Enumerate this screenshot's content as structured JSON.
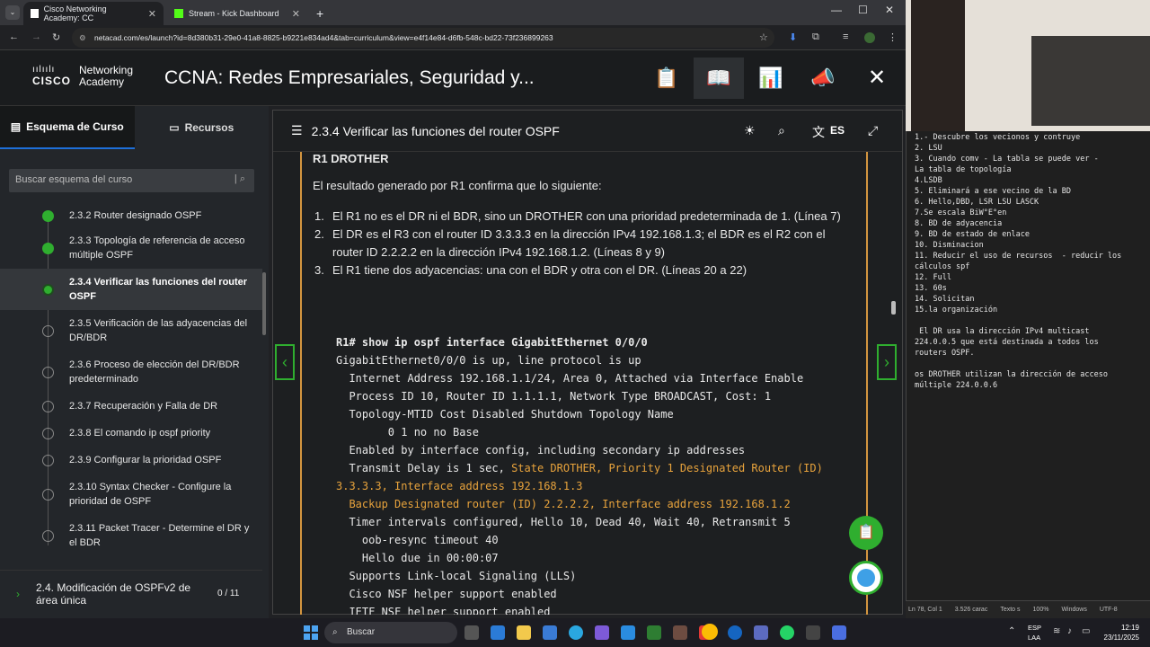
{
  "browser": {
    "tabs": [
      {
        "title": "Cisco Networking Academy: CC"
      },
      {
        "title": "Stream - Kick Dashboard"
      }
    ],
    "url": "netacad.com/es/launch?id=8d380b31-29e0-41a8-8825-b9221e834ad4&tab=curriculum&view=e4f14e84-d6fb-548c-bd22-73f236899263"
  },
  "header": {
    "brand_top": "Networking",
    "brand_bottom": "Academy",
    "cisco": "CISCO",
    "course_title": "CCNA: Redes Empresariales, Seguridad y..."
  },
  "sidebar": {
    "tab_outline": "Esquema de Curso",
    "tab_resources": "Recursos",
    "search_placeholder": "Buscar esquema del curso",
    "items": [
      {
        "label": "2.3.2 Router designado OSPF",
        "state": "done"
      },
      {
        "label": "2.3.3 Topología de referencia de acceso múltiple OSPF",
        "state": "done"
      },
      {
        "label": "2.3.4 Verificar las funciones del router OSPF",
        "state": "current"
      },
      {
        "label": "2.3.5 Verificación de las adyacencias del DR/BDR",
        "state": "todo"
      },
      {
        "label": "2.3.6 Proceso de elección del DR/BDR predeterminado",
        "state": "todo"
      },
      {
        "label": "2.3.7 Recuperación y Falla de DR",
        "state": "todo"
      },
      {
        "label": "2.3.8 El comando ip ospf priority",
        "state": "todo"
      },
      {
        "label": "2.3.9 Configurar la prioridad OSPF",
        "state": "todo"
      },
      {
        "label": "2.3.10 Syntax Checker - Configure la prioridad de OSPF",
        "state": "todo"
      },
      {
        "label": "2.3.11 Packet Tracer - Determine el DR y el BDR",
        "state": "todo"
      }
    ],
    "section": {
      "label": "2.4. Modificación de OSPFv2 de área única",
      "progress": "0 / 11"
    }
  },
  "content": {
    "title": "2.3.4 Verificar las funciones del router OSPF",
    "lang": "ES",
    "heading": "R1 DROTHER",
    "intro": "El resultado generado por R1 confirma que lo siguiente:",
    "points": [
      {
        "n": "1.",
        "text": "El R1 no es el DR ni el BDR, sino un DROTHER con una prioridad predeterminada de 1. (Línea 7)"
      },
      {
        "n": "2.",
        "text": "El DR es el R3 con el router ID 3.3.3.3 en la dirección IPv4 192.168.1.3; el BDR es el R2 con el router ID 2.2.2.2 en la dirección IPv4 192.168.1.2. (Líneas 8 y 9)"
      },
      {
        "n": "3.",
        "text": "El R1 tiene dos adyacencias: una con el BDR y otra con el DR. (Líneas 20 a 22)"
      }
    ],
    "code": {
      "l1": "R1# show ip ospf interface GigabitEthernet 0/0/0",
      "l2": "GigabitEthernet0/0/0 is up, line protocol is up",
      "l3": "  Internet Address 192.168.1.1/24, Area 0, Attached via Interface Enable",
      "l4": "  Process ID 10, Router ID 1.1.1.1, Network Type BROADCAST, Cost: 1",
      "l5": "  Topology-MTID Cost Disabled Shutdown Topology Name",
      "l6": "        0 1 no no Base",
      "l7": "  Enabled by interface config, including secondary ip addresses",
      "l8a": "  Transmit Delay is 1 sec, ",
      "l8b": "State DROTHER, Priority 1 Designated Router (ID)",
      "l9": "3.3.3.3, Interface address 192.168.1.3",
      "l10": "  Backup Designated router (ID) 2.2.2.2, Interface address 192.168.1.2",
      "l11": "  Timer intervals configured, Hello 10, Dead 40, Wait 40, Retransmit 5",
      "l12": "    oob-resync timeout 40",
      "l13": "    Hello due in 00:00:07",
      "l14": "  Supports Link-local Signaling (LLS)",
      "l15": "  Cisco NSF helper support enabled",
      "l16": "  IETF NSF helper support enabled"
    }
  },
  "notepad": {
    "lines": [
      "1.- Descubre los vecionos y contruye",
      "2. LSU",
      "3. Cuando comv - La tabla se puede ver -",
      "La tabla de topología",
      "4.LSDB",
      "5. Eliminará a ese vecino de la BD",
      "6. Hello,DBD, LSR LSU LASCK",
      "7.Se escala BiW°E°en",
      "8. BD de adyacencia",
      "9. BD de estado de enlace",
      "10. Disminacion",
      "11. Reducir el uso de recursos  - reducir los",
      "cálculos spf",
      "12. Full",
      "13. 60s",
      "14. Solicitan",
      "15.la organización",
      "",
      " El DR usa la dirección IPv4 multicast",
      "224.0.0.5 que está destinada a todos los",
      "routers OSPF.",
      "",
      "os DROTHER utilizan la dirección de acceso",
      "múltiple 224.0.0.6"
    ],
    "status": {
      "pos": "Ln 78, Col 1",
      "chars": "3.526 carac",
      "mode": "Texto s",
      "zoom": "100%",
      "eol": "Windows",
      "enc": "UTF-8"
    }
  },
  "taskbar": {
    "search": "Buscar",
    "lang1": "ESP",
    "lang2": "LAA",
    "time": "12:19",
    "date": "23/11/2025"
  }
}
